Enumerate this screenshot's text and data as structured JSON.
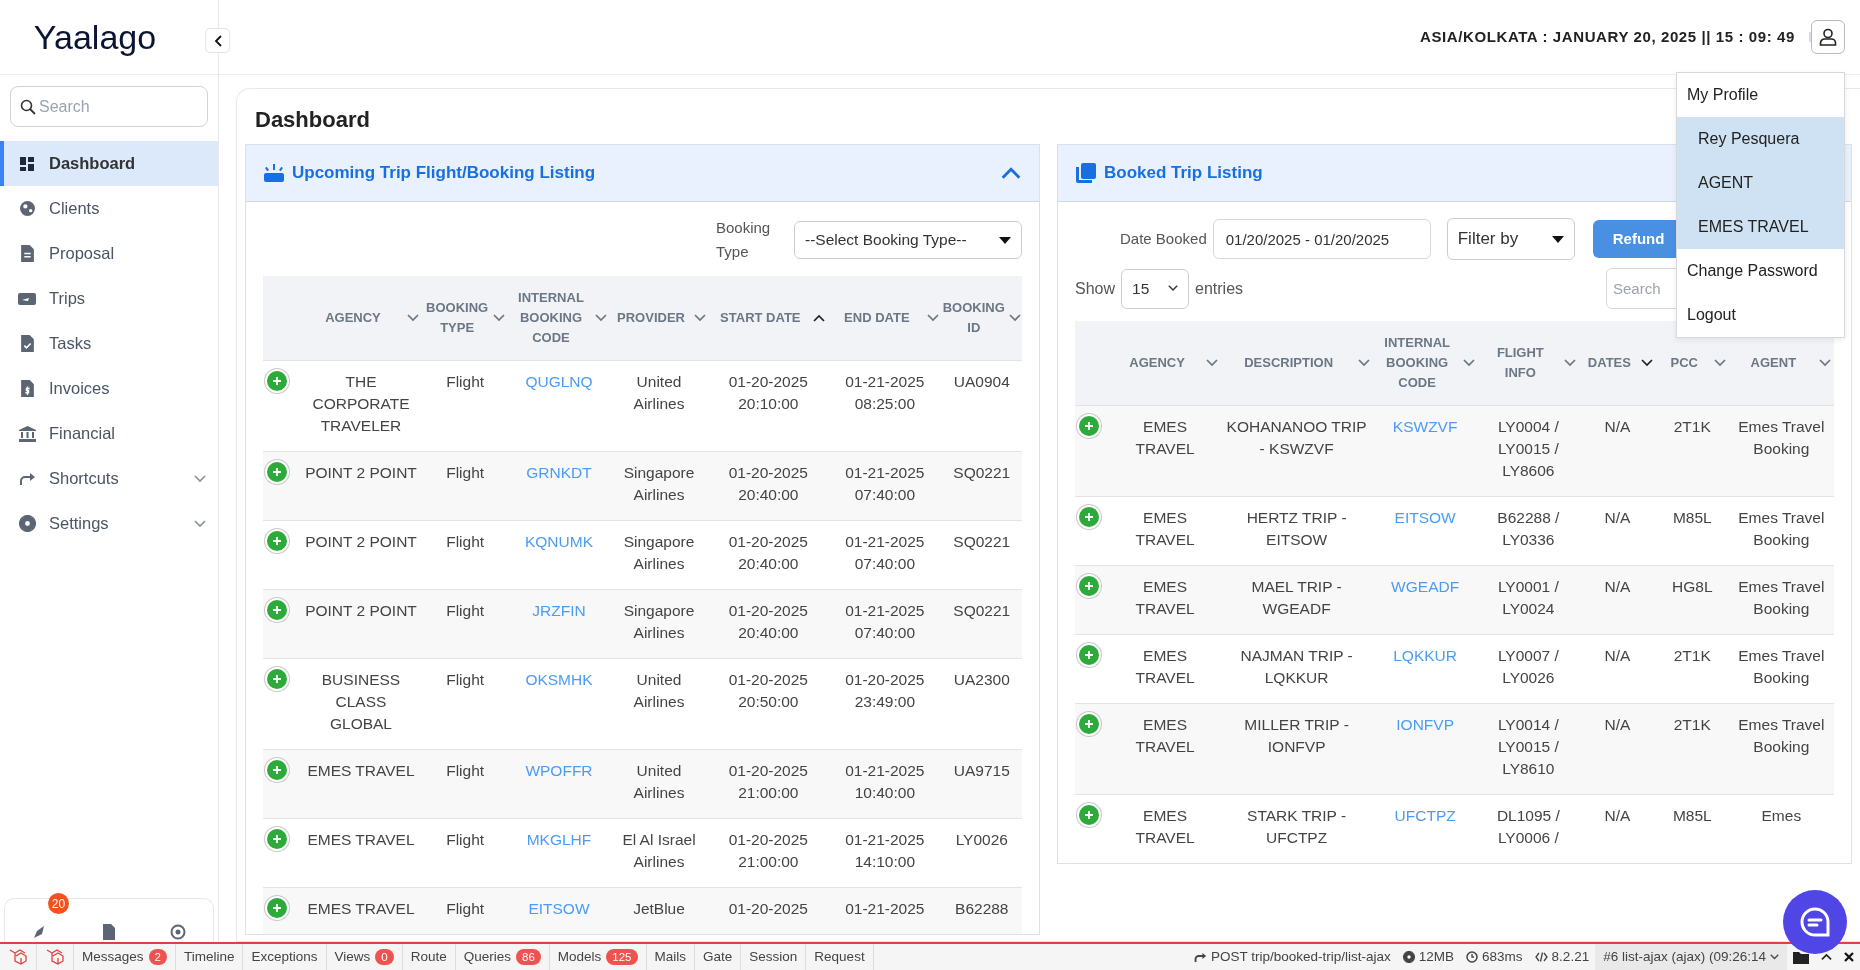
{
  "brand": {
    "name": "Yaalago"
  },
  "sidebar": {
    "search": {
      "placeholder": "Search"
    },
    "items": [
      {
        "label": "Dashboard",
        "kind": "link",
        "selected": true
      },
      {
        "label": "Clients",
        "kind": "link",
        "selected": false
      },
      {
        "label": "Proposal",
        "kind": "link",
        "selected": false
      },
      {
        "label": "Trips",
        "kind": "link",
        "selected": false
      },
      {
        "label": "Tasks",
        "kind": "link",
        "selected": false
      },
      {
        "label": "Invoices",
        "kind": "link",
        "selected": false
      },
      {
        "label": "Financial",
        "kind": "link",
        "selected": false
      },
      {
        "label": "Shortcuts",
        "kind": "group",
        "expanded": false,
        "selected": false
      },
      {
        "label": "Settings",
        "kind": "group",
        "expanded": false,
        "selected": false
      }
    ],
    "footer": {
      "badge": "20"
    }
  },
  "header": {
    "datetime": "ASIA/KOLKATA : JANUARY 20, 2025 || 15 : 09: 49"
  },
  "profile_menu": {
    "items": [
      {
        "label": "My Profile",
        "kind": "link"
      },
      {
        "label": "Rey Pesquera",
        "kind": "info"
      },
      {
        "label": "AGENT",
        "kind": "info"
      },
      {
        "label": "EMES TRAVEL",
        "kind": "info"
      },
      {
        "label": "Change Password",
        "kind": "link"
      },
      {
        "label": "Logout",
        "kind": "link"
      }
    ]
  },
  "page": {
    "title": "Dashboard"
  },
  "upcoming": {
    "title": "Upcoming Trip Flight/Booking Listing",
    "expanded": true,
    "filter": {
      "label": "Booking Type",
      "value": "--Select Booking Type--"
    },
    "columns": [
      {
        "label": "AGENCY",
        "sorted": false,
        "kind": "text"
      },
      {
        "label": "BOOKING TYPE",
        "sorted": false,
        "kind": "text"
      },
      {
        "label": "INTERNAL BOOKING CODE",
        "sorted": false,
        "kind": "link"
      },
      {
        "label": "PROVIDER",
        "sorted": false,
        "kind": "text"
      },
      {
        "label": "START DATE",
        "sorted": true,
        "ascending": true,
        "kind": "text"
      },
      {
        "label": "END DATE",
        "sorted": false,
        "kind": "text"
      },
      {
        "label": "BOOKING ID",
        "sorted": false,
        "kind": "text"
      }
    ],
    "rows": [
      {
        "cells": [
          "THE CORPORATE TRAVELER",
          "Flight",
          "QUGLNQ",
          "United Airlines",
          "01-20-2025 20:10:00",
          "01-21-2025 08:25:00",
          "UA0904"
        ]
      },
      {
        "cells": [
          "POINT 2 POINT",
          "Flight",
          "GRNKDT",
          "Singapore Airlines",
          "01-20-2025 20:40:00",
          "01-21-2025 07:40:00",
          "SQ0221"
        ]
      },
      {
        "cells": [
          "POINT 2 POINT",
          "Flight",
          "KQNUMK",
          "Singapore Airlines",
          "01-20-2025 20:40:00",
          "01-21-2025 07:40:00",
          "SQ0221"
        ]
      },
      {
        "cells": [
          "POINT 2 POINT",
          "Flight",
          "JRZFIN",
          "Singapore Airlines",
          "01-20-2025 20:40:00",
          "01-21-2025 07:40:00",
          "SQ0221"
        ]
      },
      {
        "cells": [
          "BUSINESS CLASS GLOBAL",
          "Flight",
          "OKSMHK",
          "United Airlines",
          "01-20-2025 20:50:00",
          "01-20-2025 23:49:00",
          "UA2300"
        ]
      },
      {
        "cells": [
          "EMES TRAVEL",
          "Flight",
          "WPOFFR",
          "United Airlines",
          "01-20-2025 21:00:00",
          "01-21-2025 10:40:00",
          "UA9715"
        ]
      },
      {
        "cells": [
          "EMES TRAVEL",
          "Flight",
          "MKGLHF",
          "El Al Israel Airlines",
          "01-20-2025 21:00:00",
          "01-21-2025 14:10:00",
          "LY0026"
        ]
      },
      {
        "cells": [
          "EMES TRAVEL",
          "Flight",
          "EITSOW",
          "JetBlue",
          "01-20-2025",
          "01-21-2025",
          "B62288"
        ]
      }
    ]
  },
  "booked": {
    "title": "Booked Trip Listing",
    "date_label": "Date Booked",
    "date_value": "01/20/2025 - 01/20/2025",
    "filter_value": "Filter by",
    "refund_button": "Refund",
    "show_label": "Show",
    "page_size": "15",
    "entries_label": "entries",
    "search": {
      "placeholder": "Search"
    },
    "columns": [
      {
        "label": "AGENCY",
        "sorted": false,
        "kind": "text"
      },
      {
        "label": "DESCRIPTION",
        "sorted": false,
        "kind": "text"
      },
      {
        "label": "INTERNAL BOOKING CODE",
        "sorted": false,
        "kind": "link"
      },
      {
        "label": "FLIGHT INFO",
        "sorted": false,
        "kind": "text"
      },
      {
        "label": "DATES",
        "sorted": true,
        "ascending": false,
        "kind": "text"
      },
      {
        "label": "PCC",
        "sorted": false,
        "kind": "text"
      },
      {
        "label": "AGENT",
        "sorted": false,
        "kind": "text"
      }
    ],
    "rows": [
      {
        "cells": [
          "EMES TRAVEL",
          "KOHANANOO TRIP - KSWZVF",
          "KSWZVF",
          "LY0004 / LY0015 / LY8606",
          "N/A",
          "2T1K",
          "Emes Travel Booking"
        ]
      },
      {
        "cells": [
          "EMES TRAVEL",
          "HERTZ TRIP - EITSOW",
          "EITSOW",
          "B62288 / LY0336",
          "N/A",
          "M85L",
          "Emes Travel Booking"
        ]
      },
      {
        "cells": [
          "EMES TRAVEL",
          "MAEL TRIP - WGEADF",
          "WGEADF",
          "LY0001 / LY0024",
          "N/A",
          "HG8L",
          "Emes Travel Booking"
        ]
      },
      {
        "cells": [
          "EMES TRAVEL",
          "NAJMAN TRIP - LQKKUR",
          "LQKKUR",
          "LY0007 / LY0026",
          "N/A",
          "2T1K",
          "Emes Travel Booking"
        ]
      },
      {
        "cells": [
          "EMES TRAVEL",
          "MILLER TRIP - IONFVP",
          "IONFVP",
          "LY0014 / LY0015 / LY8610",
          "N/A",
          "2T1K",
          "Emes Travel Booking"
        ]
      },
      {
        "cells": [
          "EMES TRAVEL",
          "STARK TRIP - UFCTPZ",
          "UFCTPZ",
          "DL1095 / LY0006 /",
          "N/A",
          "M85L",
          "Emes"
        ]
      }
    ]
  },
  "debugbar": {
    "items": [
      {
        "label": "Messages",
        "badge": "2"
      },
      {
        "label": "Timeline"
      },
      {
        "label": "Exceptions"
      },
      {
        "label": "Views",
        "badge": "0"
      },
      {
        "label": "Route"
      },
      {
        "label": "Queries",
        "badge": "86"
      },
      {
        "label": "Models",
        "badge": "125"
      },
      {
        "label": "Mails"
      },
      {
        "label": "Gate"
      },
      {
        "label": "Session"
      },
      {
        "label": "Request"
      }
    ],
    "request": "POST trip/booked-trip/list-ajax",
    "memory": "12MB",
    "time": "683ms",
    "php": "8.2.21",
    "ajax": "#6 list-ajax (ajax) (09:26:14"
  }
}
